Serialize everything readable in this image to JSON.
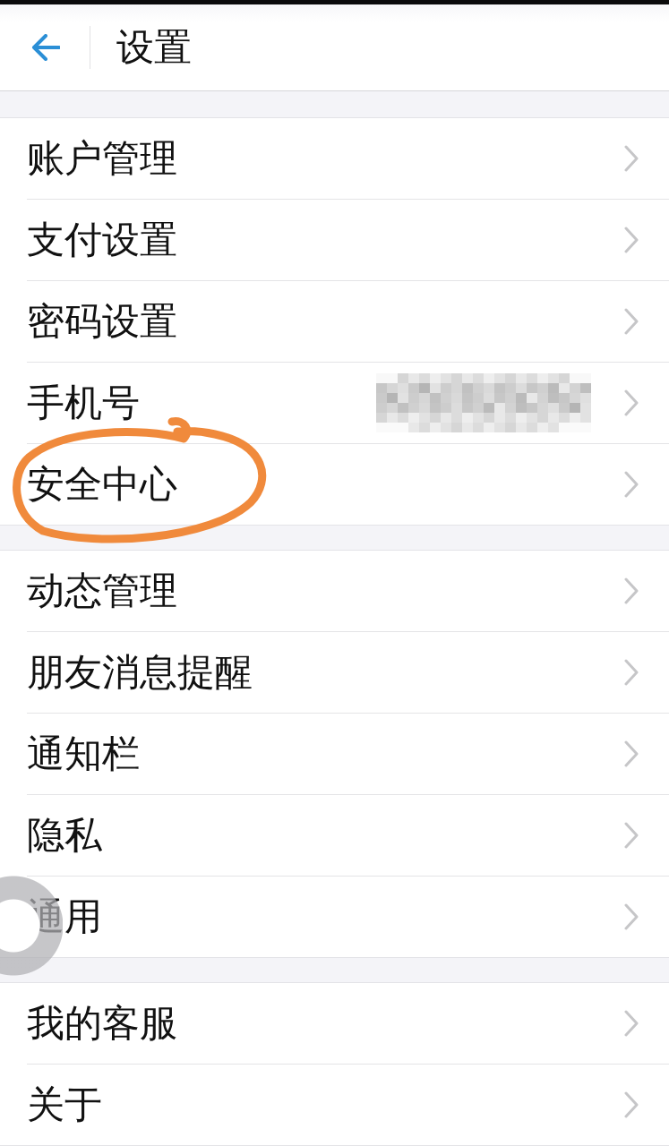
{
  "header": {
    "title": "设置"
  },
  "groups": [
    {
      "items": [
        {
          "label": "账户管理",
          "kind": "plain",
          "circled": false
        },
        {
          "label": "支付设置",
          "kind": "plain",
          "circled": false
        },
        {
          "label": "密码设置",
          "kind": "plain",
          "circled": false
        },
        {
          "label": "手机号",
          "kind": "masked",
          "circled": false
        },
        {
          "label": "安全中心",
          "kind": "plain",
          "circled": true
        }
      ]
    },
    {
      "items": [
        {
          "label": "动态管理",
          "kind": "plain",
          "circled": false
        },
        {
          "label": "朋友消息提醒",
          "kind": "plain",
          "circled": false
        },
        {
          "label": "通知栏",
          "kind": "plain",
          "circled": false
        },
        {
          "label": "隐私",
          "kind": "plain",
          "circled": false
        },
        {
          "label": "通用",
          "kind": "plain",
          "circled": false
        }
      ]
    },
    {
      "items": [
        {
          "label": "我的客服",
          "kind": "plain",
          "circled": false
        },
        {
          "label": "关于",
          "kind": "plain",
          "circled": false
        }
      ]
    }
  ]
}
